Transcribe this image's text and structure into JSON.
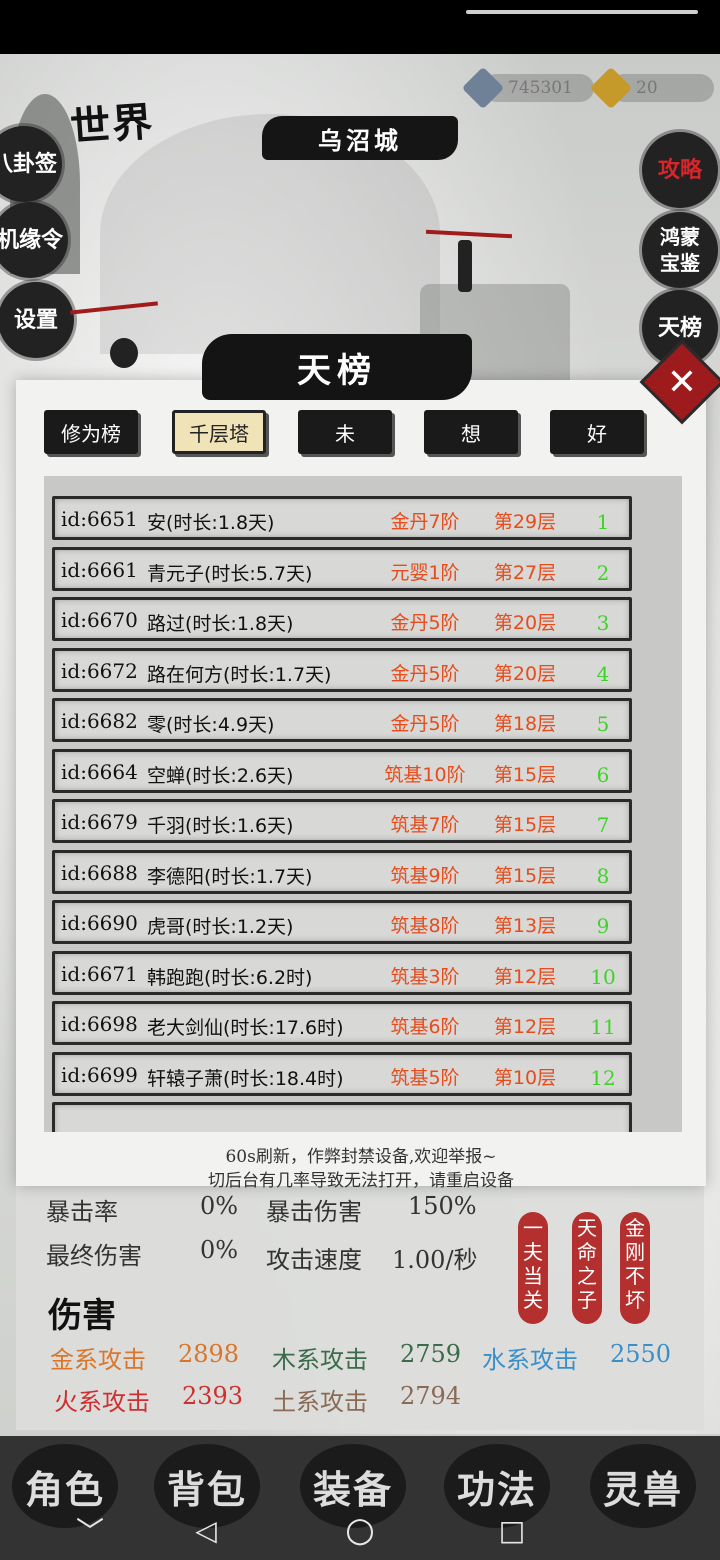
{
  "world": {
    "title": "世界",
    "city": "乌沼城"
  },
  "resources": [
    {
      "name": "spirit-stone",
      "value": "745301",
      "color": "#7d8fa3"
    },
    {
      "name": "gold-ingot",
      "value": "20",
      "color": "#c59a2b"
    }
  ],
  "left_menu": [
    "八卦签",
    "机缘令",
    "设置"
  ],
  "right_menu": [
    "攻略",
    "鸿蒙宝鉴",
    "天榜"
  ],
  "dialog": {
    "title": "天榜",
    "close": "✕",
    "tabs": [
      "修为榜",
      "千层塔",
      "未",
      "想",
      "好"
    ],
    "active_tab": 1,
    "rows": [
      {
        "id": "id:6651",
        "name": "安(时长:1.8天)",
        "realm": "金丹7阶",
        "floor": "第29层",
        "rank": "1"
      },
      {
        "id": "id:6661",
        "name": "青元子(时长:5.7天)",
        "realm": "元婴1阶",
        "floor": "第27层",
        "rank": "2"
      },
      {
        "id": "id:6670",
        "name": "路过(时长:1.8天)",
        "realm": "金丹5阶",
        "floor": "第20层",
        "rank": "3"
      },
      {
        "id": "id:6672",
        "name": "路在何方(时长:1.7天)",
        "realm": "金丹5阶",
        "floor": "第20层",
        "rank": "4"
      },
      {
        "id": "id:6682",
        "name": "零(时长:4.9天)",
        "realm": "金丹5阶",
        "floor": "第18层",
        "rank": "5"
      },
      {
        "id": "id:6664",
        "name": "空蝉(时长:2.6天)",
        "realm": "筑基10阶",
        "floor": "第15层",
        "rank": "6"
      },
      {
        "id": "id:6679",
        "name": "千羽(时长:1.6天)",
        "realm": "筑基7阶",
        "floor": "第15层",
        "rank": "7"
      },
      {
        "id": "id:6688",
        "name": "李德阳(时长:1.7天)",
        "realm": "筑基9阶",
        "floor": "第15层",
        "rank": "8"
      },
      {
        "id": "id:6690",
        "name": "虎哥(时长:1.2天)",
        "realm": "筑基8阶",
        "floor": "第13层",
        "rank": "9"
      },
      {
        "id": "id:6671",
        "name": "韩跑跑(时长:6.2时)",
        "realm": "筑基3阶",
        "floor": "第12层",
        "rank": "10"
      },
      {
        "id": "id:6698",
        "name": "老大剑仙(时长:17.6时)",
        "realm": "筑基6阶",
        "floor": "第12层",
        "rank": "11"
      },
      {
        "id": "id:6699",
        "name": "轩辕子萧(时长:18.4时)",
        "realm": "筑基5阶",
        "floor": "第10层",
        "rank": "12"
      }
    ],
    "notice_line1": "60s刷新，作弊封禁设备,欢迎举报~",
    "notice_line2": "切后台有几率导致无法打开，请重启设备"
  },
  "stats": {
    "crit_rate_label": "暴击率",
    "crit_rate": "0%",
    "crit_dmg_label": "暴击伤害",
    "crit_dmg": "150%",
    "final_dmg_label": "最终伤害",
    "final_dmg": "0%",
    "atk_speed_label": "攻击速度",
    "atk_speed": "1.00/秒",
    "damage_title": "伤害",
    "elements": [
      {
        "label": "金系攻击",
        "value": "2898",
        "color": "#d9762b"
      },
      {
        "label": "木系攻击",
        "value": "2759",
        "color": "#3a6b4a"
      },
      {
        "label": "水系攻击",
        "value": "2550",
        "color": "#3b8fc9"
      },
      {
        "label": "火系攻击",
        "value": "2393",
        "color": "#cf2f2f"
      },
      {
        "label": "土系攻击",
        "value": "2794",
        "color": "#8a6a55"
      }
    ],
    "badges": [
      "一夫当关",
      "天命之子",
      "金刚不坏"
    ]
  },
  "bottom_nav": [
    "角色",
    "背包",
    "装备",
    "功法",
    "灵兽"
  ],
  "system_nav": [
    "﹀",
    "◁",
    "○",
    "□"
  ]
}
